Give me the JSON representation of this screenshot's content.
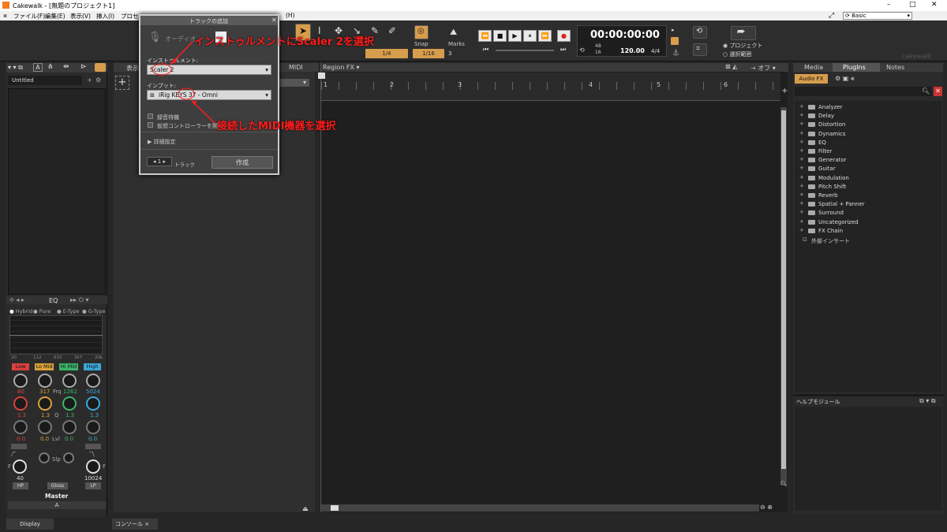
{
  "window": {
    "title": "Cakewalk - [無題のプロジェクト1]",
    "minimize": "–",
    "maximize": "□",
    "close": "✕"
  },
  "menu": [
    "ファイル(F)",
    "編集(E)",
    "表示(V)",
    "挿入(I)",
    "プロセス",
    "(H)"
  ],
  "workspace": {
    "value": "Basic"
  },
  "toolbar": {
    "quantize": "1/4",
    "snap_label": "Snap",
    "snap_value": "1/16",
    "snap_extra": "3",
    "marks_label": "Marks",
    "time": "00:00:00:00",
    "tempo": "120.00",
    "meter": "4/4",
    "bits_top": "48",
    "bits_bottom": "16",
    "range_project": "プロジェクト",
    "range_selection": "選択範囲",
    "brand": "cakewalk"
  },
  "left": {
    "untitled": "Untitled",
    "eq_title": "EQ",
    "eq_modes": [
      "Hybrid",
      "Pure",
      "E-Type",
      "G-Type"
    ],
    "eq_axis": [
      "20",
      "112",
      "632",
      "3k7",
      "20k"
    ],
    "bands": [
      "Low",
      "Lo Mid",
      "Hi Mid",
      "High"
    ],
    "band_colors": [
      "#d94040",
      "#d9a03a",
      "#3cb36a",
      "#3aa8d9"
    ],
    "freq": [
      "80",
      "317",
      "1262",
      "5024"
    ],
    "freq_label": "Frq",
    "q": [
      "1.3",
      "1.3",
      "1.3",
      "1.3"
    ],
    "q_label": "Q",
    "lvl": [
      "0.0",
      "0.0",
      "0.0",
      "0.0"
    ],
    "lvl_label": "Lvl",
    "slp_label": "Slp",
    "hp_value": "40",
    "lp_value": "10024",
    "hp": "HP",
    "gloss": "Gloss",
    "lp": "LP",
    "f_left": "F",
    "f_right": "F",
    "master": "Master",
    "a": "A",
    "display": "Display"
  },
  "track": {
    "tab_view": "表示",
    "tab_midi": "MIDI",
    "tab_region": "Region FX",
    "off": "オフ",
    "add": "+"
  },
  "ruler": [
    "1",
    "2",
    "3",
    "4",
    "5",
    "6"
  ],
  "bottom": {
    "console": "コンソール",
    "close": "×"
  },
  "right": {
    "tabs": [
      "Media",
      "PlugIns",
      "Notes"
    ],
    "audiofx": "Audio FX",
    "plugins": [
      "Analyzer",
      "Delay",
      "Distortion",
      "Dynamics",
      "EQ",
      "Filter",
      "Generator",
      "Guitar",
      "Modulation",
      "Pitch Shift",
      "Reverb",
      "Spatial + Panner",
      "Surround",
      "Uncategorized",
      "FX Chain"
    ],
    "external": "外部インサート",
    "help": "ヘルプモジュール"
  },
  "dialog": {
    "title": "トラックの追加",
    "type_audio": "オーディオ",
    "instrument_label": "インストゥルメント:",
    "instrument_value": "Scaler 2",
    "input_label": "インプット:",
    "input_value": "iRig KEYS 37 - Omni",
    "record_arm": "録音待機",
    "virtual_ctrl": "仮想コントローラーを開く",
    "details": "詳細設定",
    "count": "1",
    "count_unit": "トラック",
    "create": "作成"
  },
  "annotations": {
    "a1": "インストゥルメントにScaler 2を選択",
    "a2": "接続したMIDI機器を選択"
  }
}
